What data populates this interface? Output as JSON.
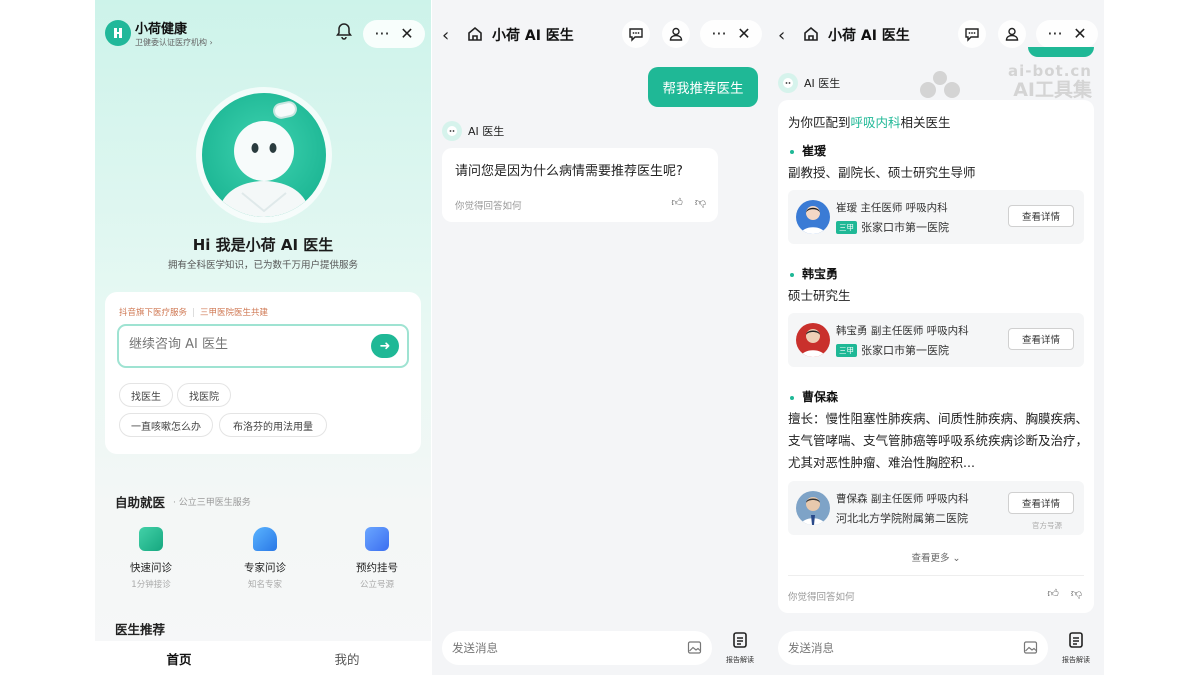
{
  "panel1": {
    "brand": {
      "name": "小荷健康",
      "sub": "卫健委认证医疗机构 ›"
    },
    "hero": {
      "title": "Hi 我是小荷 AI 医生",
      "subtitle": "拥有全科医学知识，已为数千万用户提供服务"
    },
    "tags": [
      "抖音旗下医疗服务",
      "三甲医院医生共建"
    ],
    "ask": {
      "placeholder": "继续咨询 AI 医生"
    },
    "chips": [
      "找医生",
      "找医院",
      "一直咳嗽怎么办",
      "布洛芬的用法用量"
    ],
    "self_service": {
      "title": "自助就医",
      "subtitle": "· 公立三甲医生服务",
      "items": [
        {
          "title": "快速问诊",
          "sub": "1分钟接诊"
        },
        {
          "title": "专家问诊",
          "sub": "知名专家"
        },
        {
          "title": "预约挂号",
          "sub": "公立号源"
        }
      ]
    },
    "doctor_rec": "医生推荐",
    "tabs": [
      "首页",
      "我的"
    ]
  },
  "panel2": {
    "title": "小荷 AI 医生",
    "user_msg": "帮我推荐医生",
    "bot_name": "AI 医生",
    "bot_msg": "请问您是因为什么病情需要推荐医生呢?",
    "feedback": "你觉得回答如何",
    "input_placeholder": "发送消息",
    "report_label": "报告解读"
  },
  "panel3": {
    "title": "小荷 AI 医生",
    "bot_name": "AI 医生",
    "match_prefix": "为你匹配到",
    "match_dept": "呼吸内科",
    "match_suffix": "相关医生",
    "doctors": [
      {
        "name": "崔瑷",
        "desc": "副教授、副院长、硕士研究生导师",
        "card_line": "崔瑷  主任医师  呼吸内科",
        "hospital": "张家口市第一医院",
        "badge": "三甲",
        "button": "查看详情"
      },
      {
        "name": "韩宝勇",
        "desc": "硕士研究生",
        "card_line": "韩宝勇  副主任医师  呼吸内科",
        "hospital": "张家口市第一医院",
        "badge": "三甲",
        "button": "查看详情"
      },
      {
        "name": "曹保森",
        "desc": "擅长：慢性阻塞性肺疾病、间质性肺疾病、胸膜疾病、支气管哮喘、支气管肺癌等呼吸系统疾病诊断及治疗，尤其对恶性肿瘤、难治性胸腔积...",
        "card_line": "曹保森  副主任医师  呼吸内科",
        "hospital": "河北北方学院附属第二医院",
        "badge": "",
        "button": "查看详情",
        "official": "官方号源"
      }
    ],
    "more": "查看更多 ⌄",
    "feedback": "你觉得回答如何",
    "input_placeholder": "发送消息",
    "report_label": "报告解读",
    "watermark": {
      "line1": "ai-bot.cn",
      "line2": "AI工具集"
    }
  },
  "colors": {
    "accent": "#1fb896",
    "accent_light": "#9fe3d2",
    "tag_orange": "#d07a55"
  }
}
